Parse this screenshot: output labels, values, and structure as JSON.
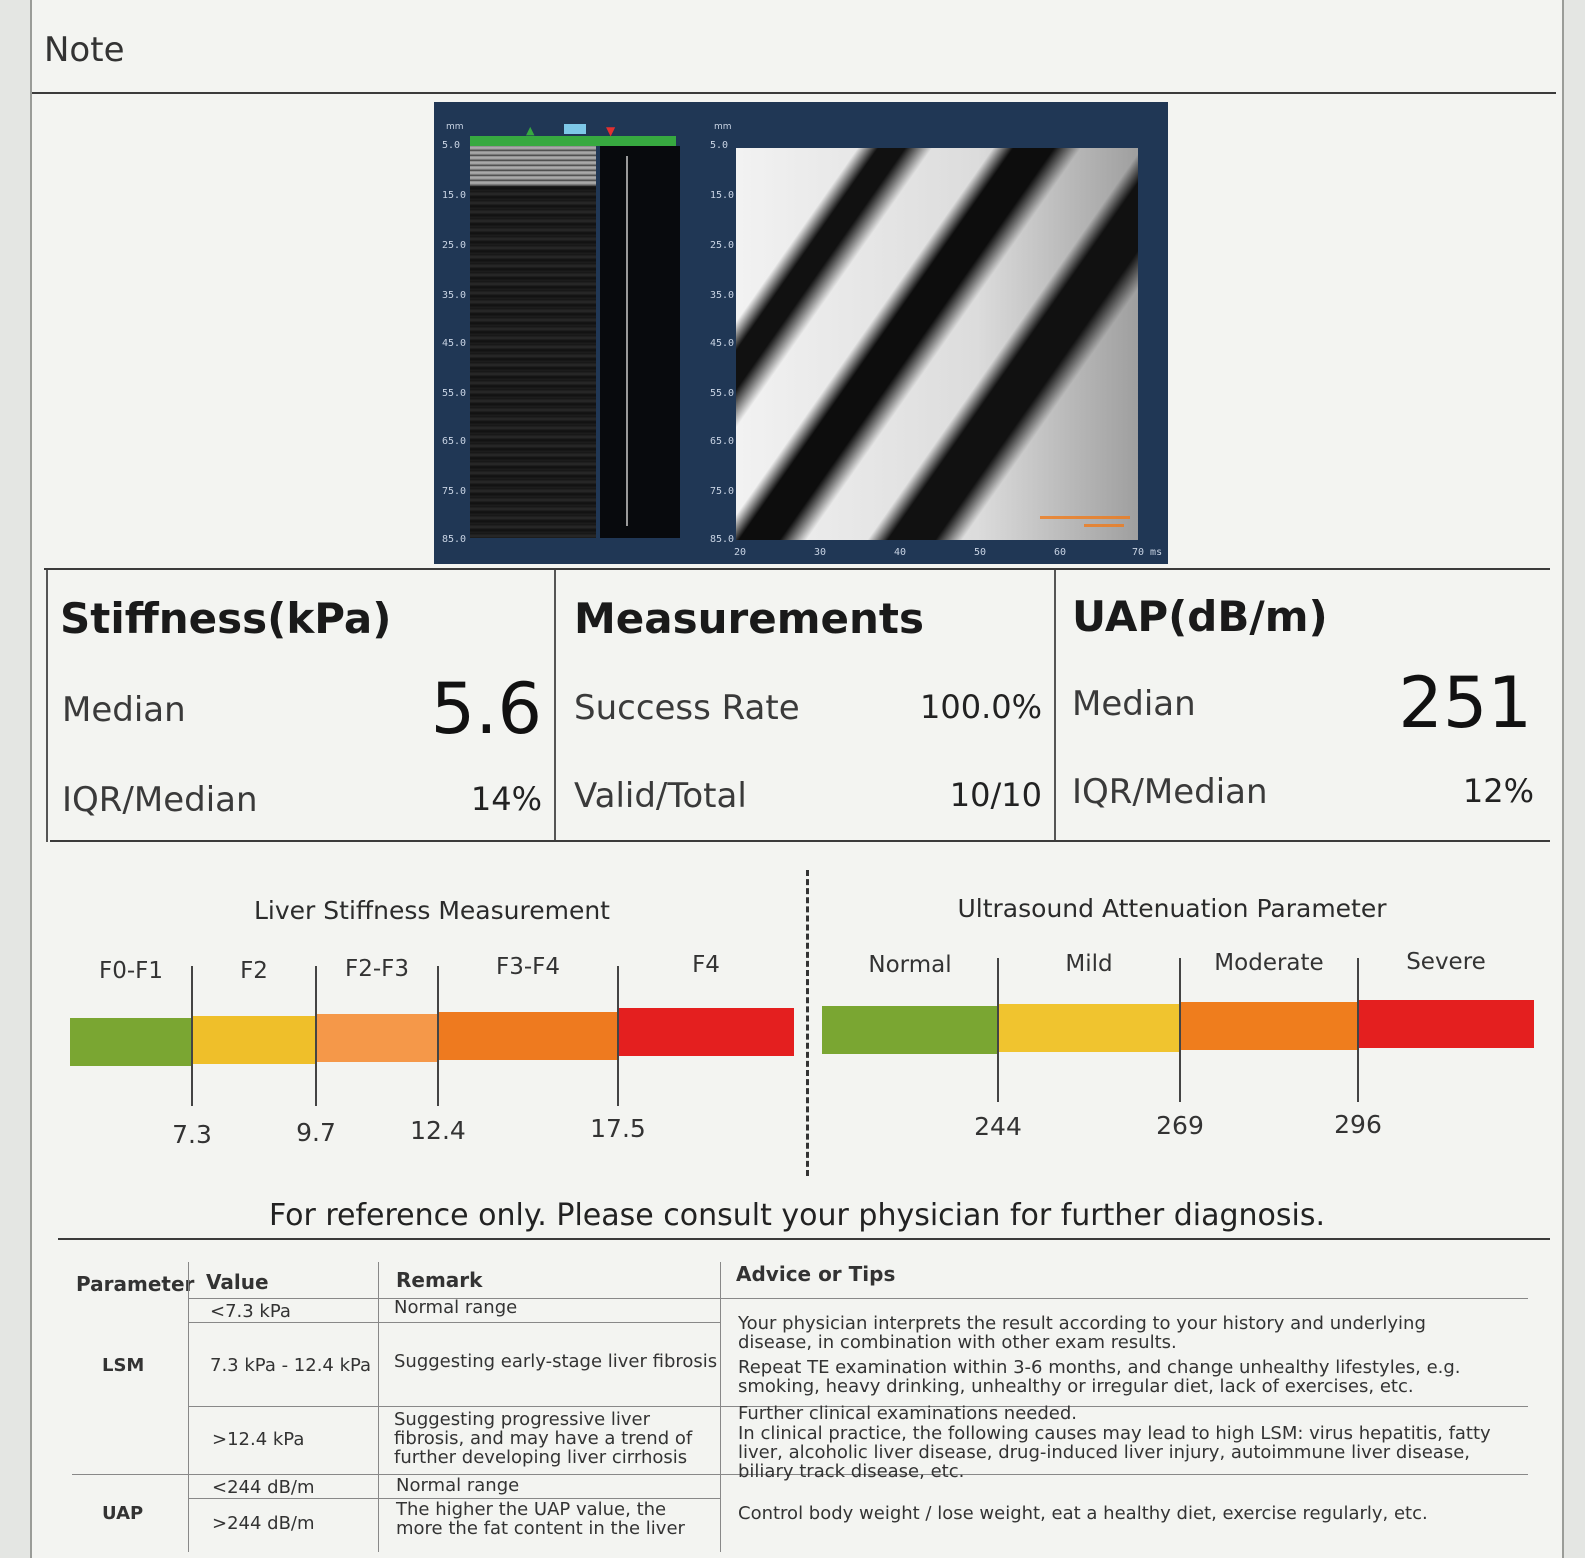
{
  "note": "Note",
  "scan": {
    "depth_unit": "mm",
    "depth_ticks": [
      "5.0",
      "15.0",
      "25.0",
      "35.0",
      "45.0",
      "55.0",
      "65.0",
      "75.0",
      "85.0"
    ],
    "time_ticks": [
      "20",
      "30",
      "40",
      "50",
      "60",
      "70 ms"
    ],
    "overlay_color": "#f07a1a"
  },
  "stiffness": {
    "title": "Stiffness(kPa)",
    "median_label": "Median",
    "median": "5.6",
    "iqr_label": "IQR/Median",
    "iqr": "14%"
  },
  "measurements": {
    "title": "Measurements",
    "success_label": "Success Rate",
    "success": "100.0%",
    "valid_label": "Valid/Total",
    "valid": "10/10"
  },
  "uap": {
    "title": "UAP(dB/m)",
    "median_label": "Median",
    "median": "251",
    "iqr_label": "IQR/Median",
    "iqr": "12%"
  },
  "lsm_scale": {
    "title": "Liver Stiffness Measurement",
    "categories": [
      "F0-F1",
      "F2",
      "F2-F3",
      "F3-F4",
      "F4"
    ],
    "thresholds": [
      "7.3",
      "9.7",
      "12.4",
      "17.5"
    ],
    "colors": [
      "#7aa632",
      "#efbf2a",
      "#f59849",
      "#ee7a1f",
      "#e41f1f"
    ]
  },
  "uap_scale": {
    "title": "Ultrasound Attenuation Parameter",
    "categories": [
      "Normal",
      "Mild",
      "Moderate",
      "Severe"
    ],
    "thresholds": [
      "244",
      "269",
      "296"
    ],
    "colors": [
      "#7aa632",
      "#f0c42f",
      "#ef7d1d",
      "#e41f1f"
    ]
  },
  "disclaimer": "For reference only. Please consult your physician for further diagnosis.",
  "table": {
    "headers": [
      "Parameter",
      "Value",
      "Remark",
      "Advice or Tips"
    ],
    "lsm": {
      "name": "LSM",
      "rows": [
        {
          "value": "<7.3 kPa",
          "remark": "Normal range"
        },
        {
          "value": "7.3 kPa - 12.4 kPa",
          "remark": "Suggesting early-stage liver fibrosis"
        },
        {
          "value": ">12.4 kPa",
          "remark": "Suggesting progressive liver fibrosis, and may have a trend of further developing liver cirrhosis"
        }
      ],
      "advice": [
        "Your physician interprets the result according to your history and underlying disease, in combination with other exam results.",
        "Repeat TE examination within 3-6 months, and change unhealthy lifestyles, e.g. smoking, heavy drinking, unhealthy or irregular diet, lack of exercises, etc.",
        "Further clinical examinations needed.",
        "In clinical practice, the following causes may lead to high LSM: virus hepatitis, fatty liver, alcoholic liver disease, drug-induced liver injury, autoimmune liver disease, biliary track disease, etc."
      ]
    },
    "uap": {
      "name": "UAP",
      "rows": [
        {
          "value": "<244 dB/m",
          "remark": "Normal range"
        },
        {
          "value": ">244 dB/m",
          "remark": "The higher the UAP value, the more the fat content in the liver"
        }
      ],
      "advice": "Control body weight / lose weight, eat a healthy diet, exercise regularly, etc."
    }
  }
}
